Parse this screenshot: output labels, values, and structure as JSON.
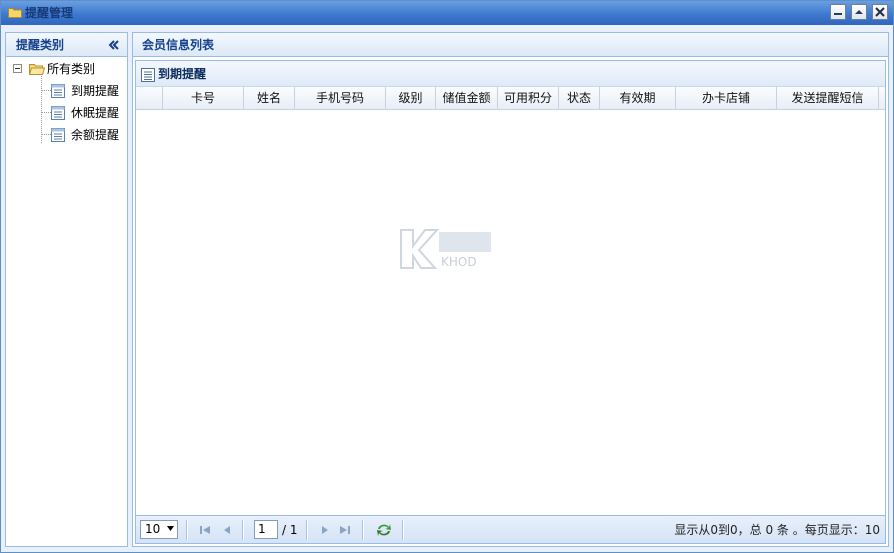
{
  "window": {
    "title": "提醒管理"
  },
  "left_panel": {
    "title": "提醒类别",
    "tree": {
      "root_label": "所有类别",
      "items": [
        {
          "label": "到期提醒"
        },
        {
          "label": "休眠提醒"
        },
        {
          "label": "余额提醒"
        }
      ]
    }
  },
  "right_panel": {
    "title": "会员信息列表",
    "grid": {
      "title": "到期提醒",
      "columns": [
        "卡号",
        "姓名",
        "手机号码",
        "级别",
        "储值金额",
        "可用积分",
        "状态",
        "有效期",
        "办卡店铺",
        "发送提醒短信"
      ],
      "rows": []
    },
    "pager": {
      "page_size": "10",
      "current_page": "1",
      "total_pages": "/ 1",
      "info": "显示从0到0，总 0 条 。每页显示：10"
    }
  },
  "watermark": {
    "text": "KHOD"
  },
  "colors": {
    "title_bar": "#3f79cf",
    "panel_border": "#99bbe8",
    "header_text": "#15428b"
  }
}
